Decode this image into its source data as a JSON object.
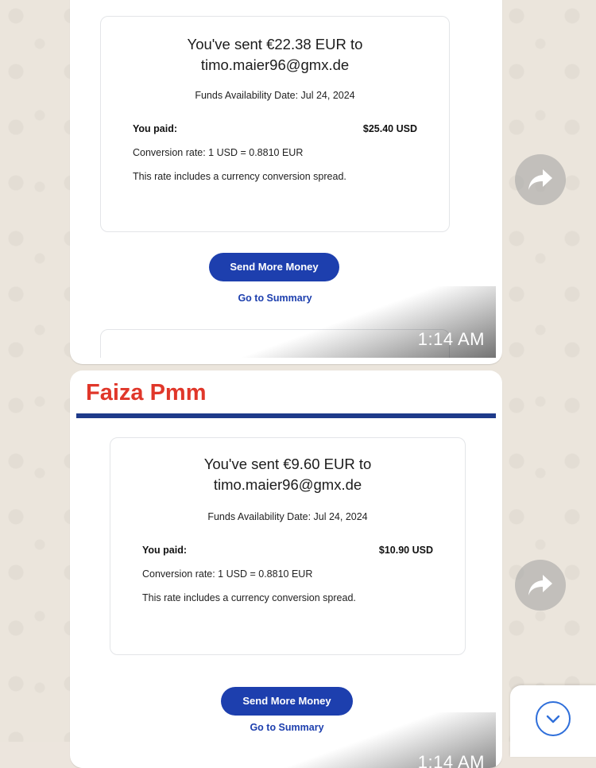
{
  "messages": [
    {
      "sender": "",
      "sent_line_1": "You've sent €22.38 EUR to",
      "sent_line_2": "timo.maier96@gmx.de",
      "availability": "Funds Availability Date: Jul 24, 2024",
      "paid_label": "You paid:",
      "paid_value": "$25.40 USD",
      "conversion_rate": "Conversion rate: 1 USD = 0.8810 EUR",
      "spread_note": "This rate includes a currency conversion spread.",
      "send_more_label": "Send More Money",
      "summary_label": "Go to Summary",
      "time": "1:14 AM"
    },
    {
      "sender": "Faiza Pmm",
      "sent_line_1": "You've sent €9.60 EUR to",
      "sent_line_2": "timo.maier96@gmx.de",
      "availability": "Funds Availability Date: Jul 24, 2024",
      "paid_label": "You paid:",
      "paid_value": "$10.90 USD",
      "conversion_rate": "Conversion rate: 1 USD = 0.8810 EUR",
      "spread_note": "This rate includes a currency conversion spread.",
      "send_more_label": "Send More Money",
      "summary_label": "Go to Summary",
      "time": "1:14 AM"
    }
  ],
  "icons": {
    "forward": "forward-arrow-icon",
    "scroll_down": "chevron-down-icon"
  },
  "colors": {
    "sender_name": "#e0372a",
    "button_blue": "#1d3fae",
    "wallpaper": "#ebe5dc",
    "scroll_accent": "#2f6fda"
  }
}
